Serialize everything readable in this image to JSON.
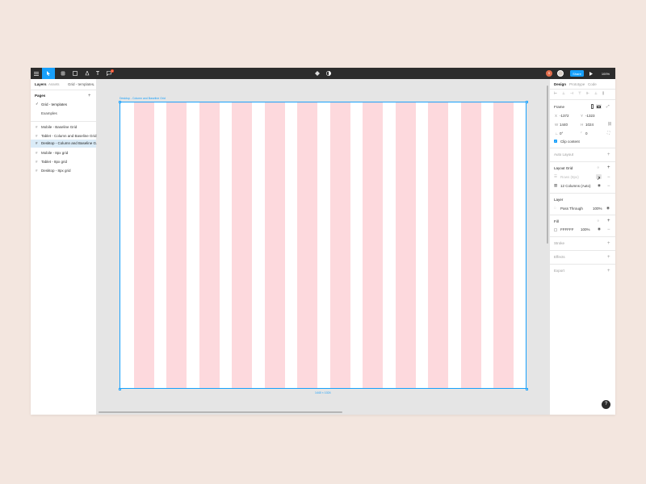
{
  "toolbar": {
    "menu_icon": "hamburger-icon",
    "zoom": "100%",
    "share_label": "Share",
    "notification_count": "1",
    "avatar_initial": "S"
  },
  "left_panel": {
    "tabs": [
      "Layers",
      "Assets"
    ],
    "page_selector": "Grid - templates",
    "pages_title": "Pages",
    "pages": [
      "Grid - templates",
      "Examples"
    ],
    "layers": [
      "Mobile - Baseline Grid",
      "Tablet - Column and Baseline Grid",
      "Desktop - Column and Baseline G...",
      "Mobile - 8px grid",
      "Tablet - 8px grid",
      "Desktop - 8px grid"
    ]
  },
  "canvas": {
    "frame_label": "Desktop - Column and Baseline Grid",
    "frame_size": "1440 × 1024",
    "columns_count": 12
  },
  "right_panel": {
    "tabs": [
      "Design",
      "Prototype",
      "Code"
    ],
    "frame_title": "Frame",
    "x_label": "X",
    "x": "-1372",
    "y_label": "Y",
    "y": "-1323",
    "w_label": "W",
    "w": "1440",
    "h_label": "H",
    "h": "1024",
    "rotation": "0°",
    "radius": "0",
    "clip_content": "Clip content",
    "auto_layout": "Auto Layout",
    "layout_grid": "Layout Grid",
    "grid_rows": "Rows (8px)",
    "grid_columns": "12 Columns (Auto)",
    "layer_title": "Layer",
    "blend": "Pass Through",
    "layer_opacity": "100%",
    "fill_title": "Fill",
    "fill_hex": "FFFFFF",
    "fill_opacity": "100%",
    "stroke": "Stroke",
    "effects": "Effects",
    "export": "Export"
  },
  "help_label": "?",
  "colors": {
    "accent": "#18a0fb",
    "grid": "#fdd9dd",
    "toolbar": "#2c2c2c",
    "background": "#f3e6df"
  }
}
